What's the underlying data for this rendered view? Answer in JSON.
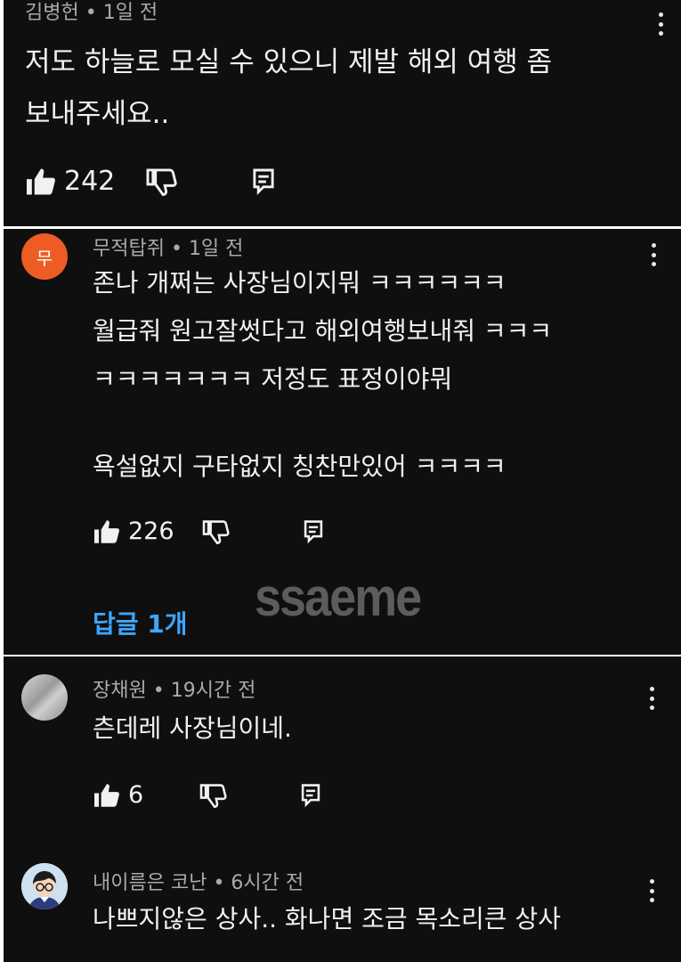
{
  "comments": [
    {
      "author": "김병헌",
      "time": "• 1일 전",
      "lines": [
        "저도 하늘로 모실 수 있으니 제발 해외 여행 좀",
        "보내주세요.."
      ],
      "likes": "242",
      "avatar": {
        "icon": "none"
      }
    },
    {
      "author": "무적탑쥐",
      "time": "• 1일 전",
      "avatar": {
        "letter": "무",
        "color": "#ef5b24"
      },
      "lines": [
        "존나 개쩌는 사장님이지뭐 ㅋㅋㅋㅋㅋㅋ",
        "월급줘 원고잘썻다고 해외여행보내줘 ㅋㅋㅋ",
        "ㅋㅋㅋㅋㅋㅋㅋ 저정도 표정이야뭐",
        "",
        "욕설없지 구타없지  칭찬만있어 ㅋㅋㅋㅋ"
      ],
      "likes": "226",
      "replies": "답글 1개"
    },
    {
      "author": "장채원",
      "time": "• 19시간 전",
      "avatar": {
        "icon": "photo"
      },
      "lines": [
        "츤데레 사장님이네."
      ],
      "likes": "6"
    },
    {
      "author": "내이름은 코난",
      "time": "• 6시간 전",
      "avatar": {
        "icon": "cartoon-boy"
      },
      "lines": [
        "나쁘지않은 상사.. 화나면 조금 목소리큰 상사"
      ]
    }
  ],
  "watermark": "ssaeme",
  "colors": {
    "background": "#0f0f0f",
    "text": "#f1f1f1",
    "meta": "#aaaaaa",
    "link": "#3ea6ff",
    "accent": "#ef5b24"
  },
  "icons": {
    "like": "thumb-up-icon",
    "dislike": "thumb-down-icon",
    "reply": "reply-icon",
    "menu": "kebab-menu-icon"
  }
}
